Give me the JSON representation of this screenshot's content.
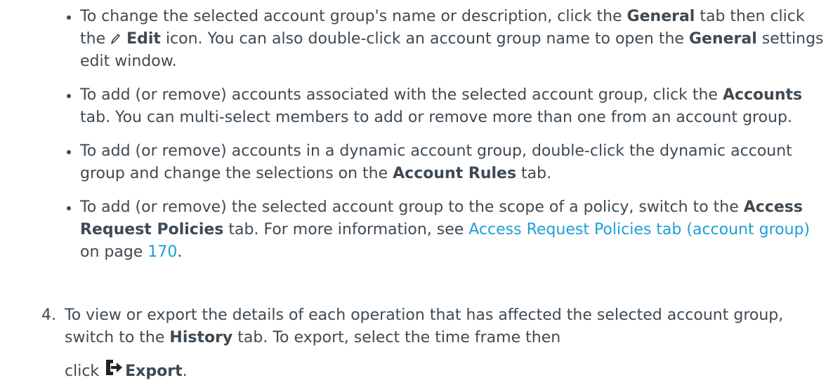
{
  "bullets": [
    {
      "t1": "To change the selected account group's name or description, click the ",
      "b1": "General",
      "t2": " tab then click the ",
      "icon": "pencil-icon",
      "b2": "Edit",
      "t3": " icon. You can also double-click an account group name to open the ",
      "b3": "General",
      "t4": " settings edit window."
    },
    {
      "t1": "To add (or remove) accounts associated with the selected account group, click the ",
      "b1": "Accounts",
      "t2": " tab. You can multi-select members to add or remove more than one from an account group."
    },
    {
      "t1": "To add (or remove) accounts in a dynamic account group, double-click the dynamic account group and change the selections on the ",
      "b1": "Account Rules",
      "t2": " tab."
    },
    {
      "t1": "To add (or remove) the selected account group to the scope of a policy, switch to the ",
      "b1": "Access Request Policies",
      "t2": " tab. For more information, see ",
      "link": "Access Request Policies tab (account group)",
      "t3": " on page ",
      "page": "170",
      "t4": "."
    }
  ],
  "step4": {
    "number": "4.",
    "t1": "To view or export the details of each operation that has affected the selected account group, switch to the ",
    "b1": "History",
    "t2": " tab. To export, select the time frame then",
    "t3": "click ",
    "icon": "export-icon",
    "b2": "Export",
    "t4": "."
  },
  "colors": {
    "text": "#3f4a53",
    "link": "#1aa0d6"
  }
}
